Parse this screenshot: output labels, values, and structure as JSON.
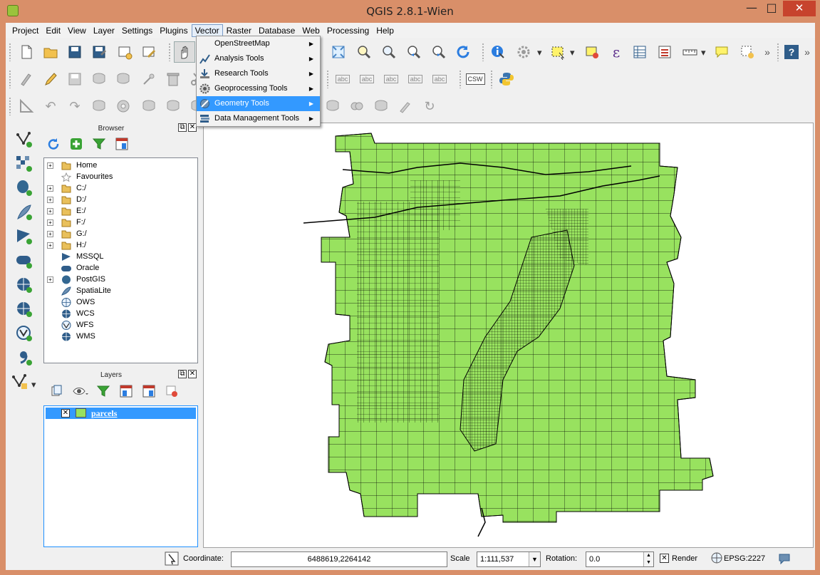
{
  "window": {
    "title": "QGIS 2.8.1-Wien",
    "min_glyph": "—",
    "max_glyph": "□",
    "close_glyph": "✕"
  },
  "menubar": [
    "Project",
    "Edit",
    "View",
    "Layer",
    "Settings",
    "Plugins",
    "Vector",
    "Raster",
    "Database",
    "Web",
    "Processing",
    "Help"
  ],
  "active_menu": "Vector",
  "vector_menu": {
    "items": [
      {
        "label": "OpenStreetMap",
        "icon": "none",
        "highlighted": false
      },
      {
        "label": "Analysis Tools",
        "icon": "analysis-icon",
        "highlighted": false
      },
      {
        "label": "Research Tools",
        "icon": "research-icon",
        "highlighted": false
      },
      {
        "label": "Geoprocessing Tools",
        "icon": "gear-icon",
        "highlighted": false
      },
      {
        "label": "Geometry Tools",
        "icon": "geometry-icon",
        "highlighted": true
      },
      {
        "label": "Data Management Tools",
        "icon": "data-management-icon",
        "highlighted": false
      }
    ],
    "submenu_glyph": "▶"
  },
  "toolbar": {
    "csw_label": "CSW",
    "more_glyph": "»",
    "label_glyph": "abc",
    "help_glyph": "?"
  },
  "browser": {
    "title": "Browser",
    "items": [
      {
        "label": "Home",
        "icon": "folder-icon",
        "expandable": true
      },
      {
        "label": "Favourites",
        "icon": "star-icon",
        "expandable": false
      },
      {
        "label": "C:/",
        "icon": "folder-icon",
        "expandable": true
      },
      {
        "label": "D:/",
        "icon": "folder-icon",
        "expandable": true
      },
      {
        "label": "E:/",
        "icon": "folder-icon",
        "expandable": true
      },
      {
        "label": "F:/",
        "icon": "folder-icon",
        "expandable": true
      },
      {
        "label": "G:/",
        "icon": "folder-icon",
        "expandable": true
      },
      {
        "label": "H:/",
        "icon": "folder-icon",
        "expandable": true
      },
      {
        "label": "MSSQL",
        "icon": "mssql-icon",
        "expandable": false
      },
      {
        "label": "Oracle",
        "icon": "oracle-icon",
        "expandable": false
      },
      {
        "label": "PostGIS",
        "icon": "postgis-icon",
        "expandable": true
      },
      {
        "label": "SpatiaLite",
        "icon": "spatialite-icon",
        "expandable": false
      },
      {
        "label": "OWS",
        "icon": "ows-icon",
        "expandable": false
      },
      {
        "label": "WCS",
        "icon": "wcs-icon",
        "expandable": false
      },
      {
        "label": "WFS",
        "icon": "wfs-icon",
        "expandable": false
      },
      {
        "label": "WMS",
        "icon": "wms-icon",
        "expandable": false
      }
    ]
  },
  "layers": {
    "title": "Layers",
    "items": [
      {
        "name": "parcels",
        "checked": true,
        "swatch_color": "#98e25f"
      }
    ]
  },
  "panel_glyphs": {
    "float": "⧉",
    "close": "✕",
    "expand": "+",
    "check": "✕"
  },
  "map": {
    "fill_color": "#98e25f",
    "stroke_color": "#000000"
  },
  "statusbar": {
    "coordinate_label": "Coordinate:",
    "coordinate_value": "6488619,2264142",
    "scale_label": "Scale",
    "scale_value": "1:111,537",
    "rotation_label": "Rotation:",
    "rotation_value": "0.0",
    "render_label": "Render",
    "render_checked": true,
    "crs_label": "EPSG:2227"
  }
}
